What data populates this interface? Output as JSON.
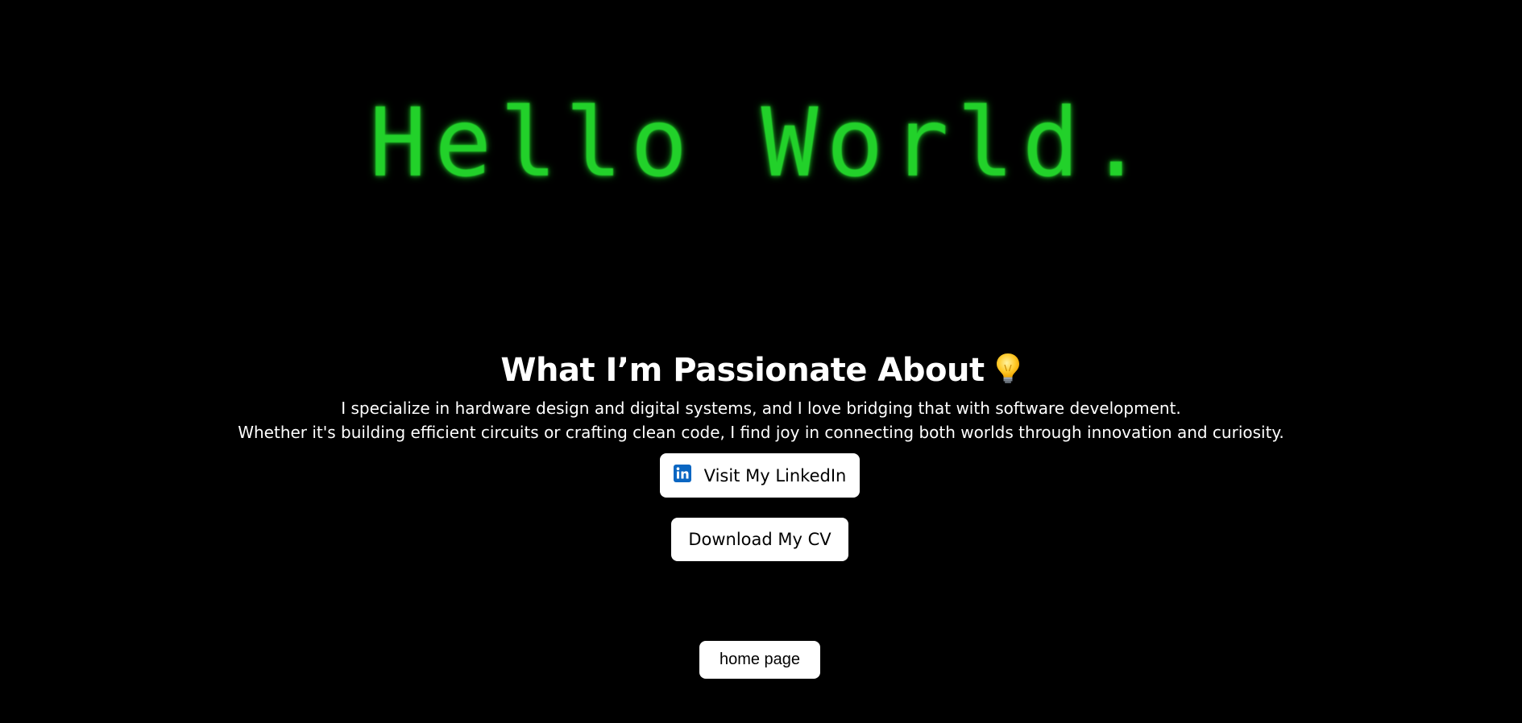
{
  "hero": {
    "title": "Hello World."
  },
  "about": {
    "title": "What I’m Passionate About",
    "icon": "lightbulb-icon",
    "description_lines": [
      "I specialize in hardware design and digital systems, and I love bridging that with software development.",
      "Whether it's building efficient circuits or crafting clean code, I find joy in connecting both worlds through innovation and curiosity."
    ]
  },
  "buttons": {
    "linkedin": {
      "label": "Visit My LinkedIn",
      "icon": "linkedin-icon"
    },
    "cv": {
      "label": "Download My CV"
    },
    "home": {
      "label": "home page"
    }
  },
  "colors": {
    "background": "#000000",
    "hero_text": "#22d12a",
    "text": "#ffffff",
    "button_bg": "#ffffff",
    "linkedin_blue": "#0a66c2"
  }
}
